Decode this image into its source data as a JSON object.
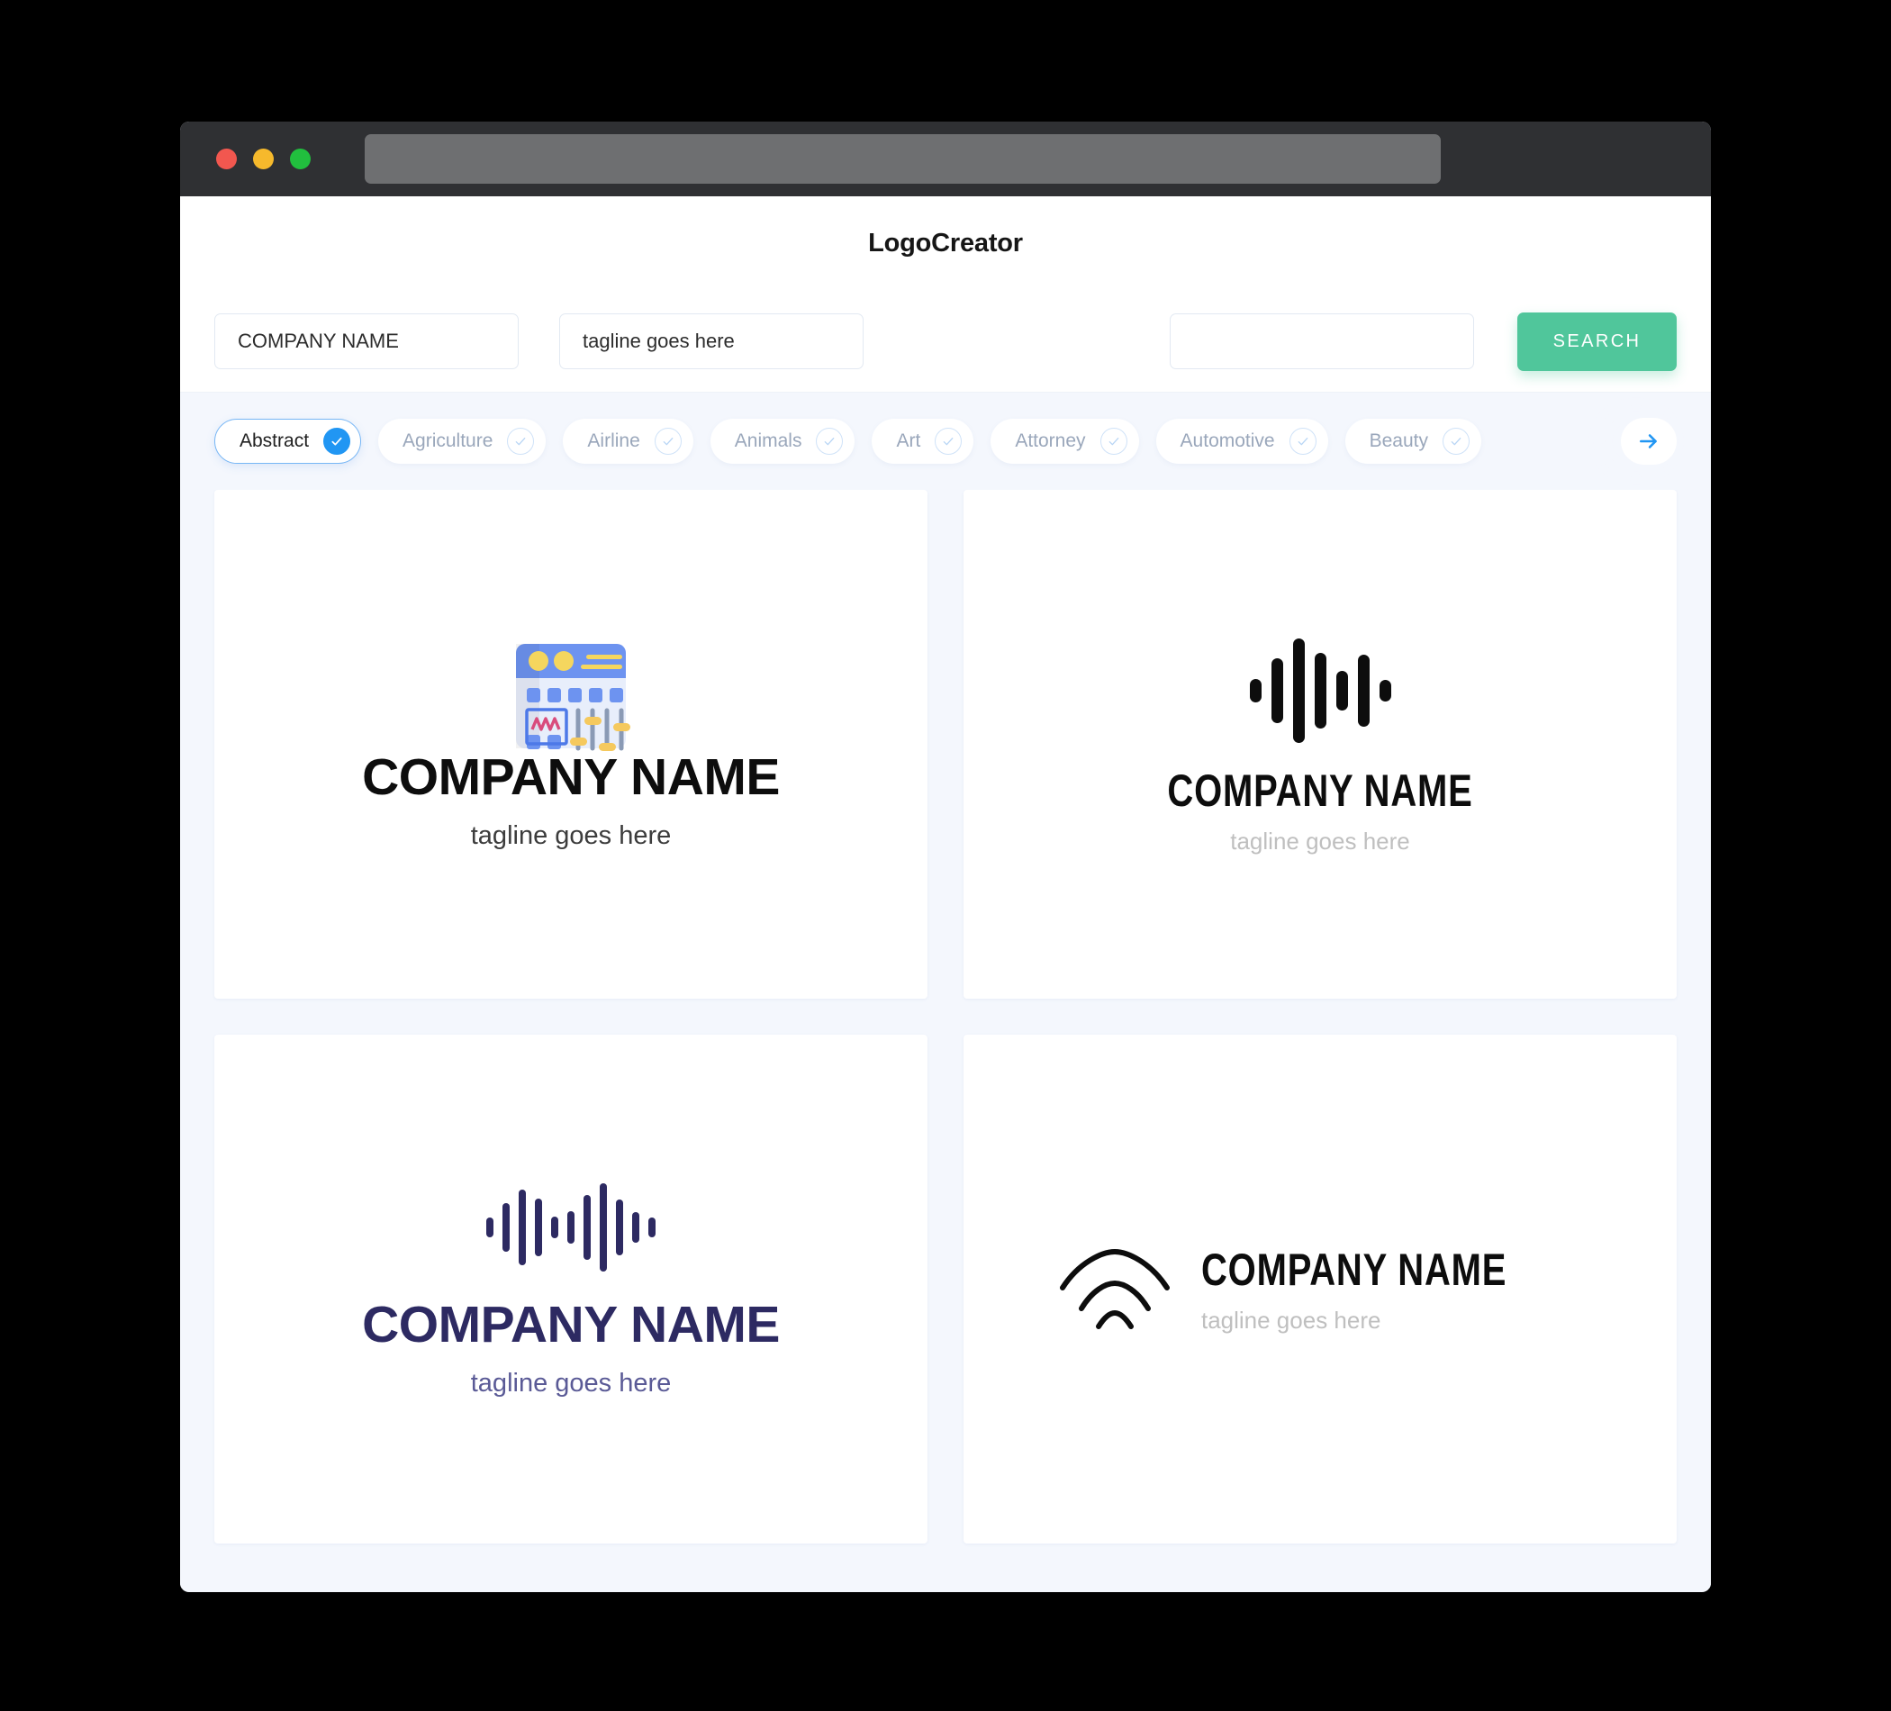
{
  "window": {
    "traffic_lights": [
      "close",
      "minimize",
      "maximize"
    ],
    "url_value": ""
  },
  "header": {
    "app_title": "LogoCreator"
  },
  "search": {
    "company_value": "COMPANY NAME",
    "company_placeholder": "COMPANY NAME",
    "tagline_value": "tagline goes here",
    "tagline_placeholder": "tagline goes here",
    "keyword_value": "",
    "keyword_placeholder": "",
    "search_label": "SEARCH",
    "search_button_color": "#50c69b"
  },
  "categories": {
    "next_icon": "arrow-right-icon",
    "accent_color": "#2196f3",
    "items": [
      {
        "label": "Abstract",
        "selected": true,
        "icon": "check-icon"
      },
      {
        "label": "Agriculture",
        "selected": false,
        "icon": "check-icon"
      },
      {
        "label": "Airline",
        "selected": false,
        "icon": "check-icon"
      },
      {
        "label": "Animals",
        "selected": false,
        "icon": "check-icon"
      },
      {
        "label": "Art",
        "selected": false,
        "icon": "check-icon"
      },
      {
        "label": "Attorney",
        "selected": false,
        "icon": "check-icon"
      },
      {
        "label": "Automotive",
        "selected": false,
        "icon": "check-icon"
      },
      {
        "label": "Beauty",
        "selected": false,
        "icon": "check-icon"
      }
    ]
  },
  "results": [
    {
      "icon": "audio-mixer-icon",
      "name": "COMPANY NAME",
      "tagline": "tagline goes here",
      "name_color": "#0d0d0d",
      "tagline_color": "#3c3c3c"
    },
    {
      "icon": "sound-wave-icon",
      "name": "COMPANY NAME",
      "tagline": "tagline goes here",
      "name_color": "#0d0d0d",
      "tagline_color": "#bfbfbf"
    },
    {
      "icon": "sound-wave-dense-icon",
      "name": "COMPANY NAME",
      "tagline": "tagline goes here",
      "name_color": "#2d2a62",
      "tagline_color": "#5a5a96"
    },
    {
      "icon": "wifi-signal-icon",
      "name": "COMPANY NAME",
      "tagline": "tagline goes here",
      "name_color": "#0d0d0d",
      "tagline_color": "#bfbfbf"
    }
  ]
}
